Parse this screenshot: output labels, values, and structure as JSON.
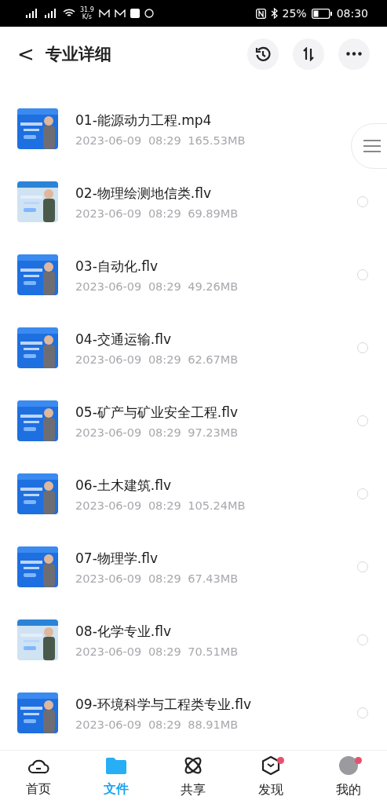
{
  "status_bar": {
    "speed_value": "31.9",
    "speed_unit": "K/s",
    "battery": "25%",
    "time": "08:30"
  },
  "header": {
    "back": "<",
    "title": "专业详细"
  },
  "files": [
    {
      "name": "01-能源动力工程.mp4",
      "date": "2023-06-09",
      "time": "08:29",
      "size": "165.53MB"
    },
    {
      "name": "02-物理绘测地信类.flv",
      "date": "2023-06-09",
      "time": "08:29",
      "size": "69.89MB",
      "selected": false
    },
    {
      "name": "03-自动化.flv",
      "date": "2023-06-09",
      "time": "08:29",
      "size": "49.26MB",
      "selected": false
    },
    {
      "name": "04-交通运输.flv",
      "date": "2023-06-09",
      "time": "08:29",
      "size": "62.67MB",
      "selected": false
    },
    {
      "name": "05-矿产与矿业安全工程.flv",
      "date": "2023-06-09",
      "time": "08:29",
      "size": "97.23MB",
      "selected": false
    },
    {
      "name": "06-土木建筑.flv",
      "date": "2023-06-09",
      "time": "08:29",
      "size": "105.24MB",
      "selected": false
    },
    {
      "name": "07-物理学.flv",
      "date": "2023-06-09",
      "time": "08:29",
      "size": "67.43MB",
      "selected": false
    },
    {
      "name": "08-化学专业.flv",
      "date": "2023-06-09",
      "time": "08:29",
      "size": "70.51MB",
      "selected": false
    },
    {
      "name": "09-环境科学与工程类专业.flv",
      "date": "2023-06-09",
      "time": "08:29",
      "size": "88.91MB",
      "selected": false
    }
  ],
  "tabs": [
    {
      "label": "首页",
      "kind": "cloud",
      "selected": false,
      "badge": false
    },
    {
      "label": "文件",
      "kind": "folder",
      "selected": true,
      "badge": false
    },
    {
      "label": "共享",
      "kind": "orbit",
      "selected": false,
      "badge": false
    },
    {
      "label": "发现",
      "kind": "hexagon",
      "selected": false,
      "badge": true
    },
    {
      "label": "我的",
      "kind": "avatar",
      "selected": false,
      "badge": true
    }
  ]
}
